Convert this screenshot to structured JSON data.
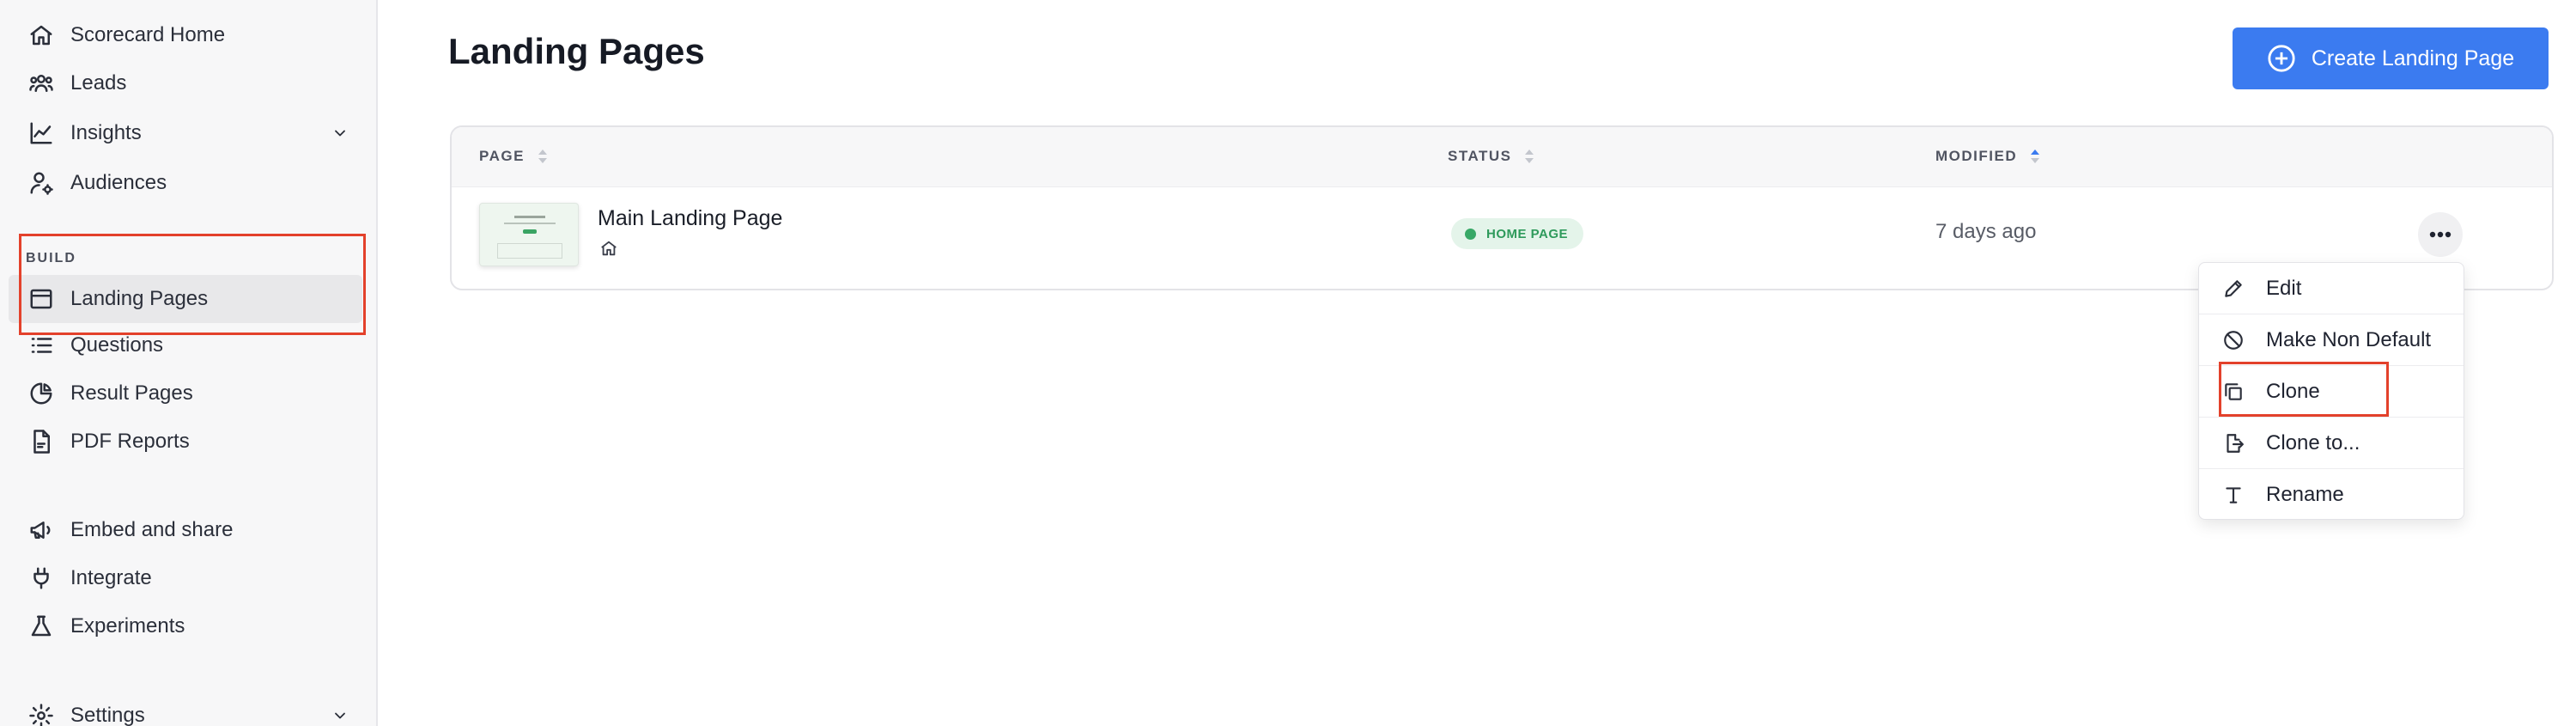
{
  "sidebar": {
    "items_top": [
      {
        "label": "Scorecard Home",
        "icon": "home-icon"
      },
      {
        "label": "Leads",
        "icon": "users-icon"
      },
      {
        "label": "Insights",
        "icon": "chart-line-icon"
      },
      {
        "label": "Audiences",
        "icon": "user-settings-icon"
      }
    ],
    "section_build": "BUILD",
    "items_build": [
      {
        "label": "Landing Pages",
        "icon": "browser-window-icon"
      },
      {
        "label": "Questions",
        "icon": "list-icon"
      },
      {
        "label": "Result Pages",
        "icon": "pie-chart-icon"
      },
      {
        "label": "PDF Reports",
        "icon": "pdf-file-icon"
      }
    ],
    "items_bottom": [
      {
        "label": "Embed and share",
        "icon": "megaphone-icon"
      },
      {
        "label": "Integrate",
        "icon": "plug-icon"
      },
      {
        "label": "Experiments",
        "icon": "flask-icon"
      }
    ],
    "settings_label": "Settings"
  },
  "main": {
    "title": "Landing Pages",
    "create_button": "Create Landing Page",
    "table": {
      "columns": [
        "PAGE",
        "STATUS",
        "MODIFIED"
      ],
      "rows": [
        {
          "name": "Main Landing Page",
          "status": "HOME PAGE",
          "modified": "7 days ago"
        }
      ]
    },
    "menu": {
      "items": [
        {
          "label": "Edit",
          "icon": "pencil-icon"
        },
        {
          "label": "Make Non Default",
          "icon": "ban-icon"
        },
        {
          "label": "Clone",
          "icon": "copy-icon"
        },
        {
          "label": "Clone to...",
          "icon": "file-export-icon"
        },
        {
          "label": "Rename",
          "icon": "text-icon"
        }
      ]
    }
  },
  "colors": {
    "accent": "#3b7bf0",
    "highlight": "#e3412b",
    "status_green": "#37a866"
  }
}
